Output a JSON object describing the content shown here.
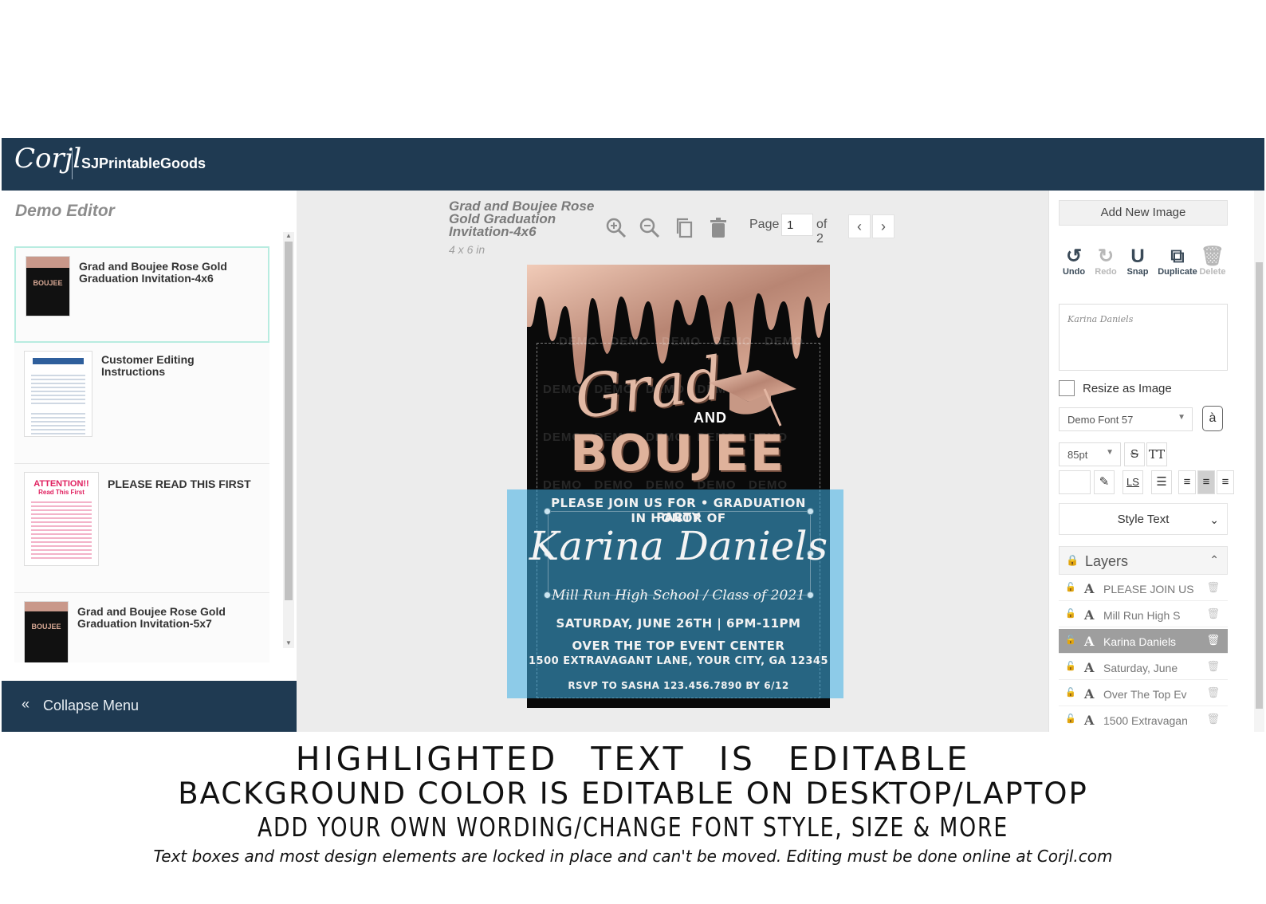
{
  "app": {
    "logo": "Corjl",
    "shop_name": "SJPrintableGoods"
  },
  "left_panel": {
    "title": "Demo Editor",
    "templates": [
      {
        "label": "Grad and Boujee Rose Gold Graduation Invitation-4x6",
        "selected": true
      },
      {
        "label": "Customer Editing Instructions",
        "selected": false
      },
      {
        "label": "PLEASE READ THIS FIRST",
        "selected": false
      },
      {
        "label": "Grad and Boujee Rose Gold Graduation Invitation-5x7",
        "selected": false
      }
    ],
    "thumb_attention": {
      "title": "ATTENTION!!",
      "subtitle": "Read This First"
    },
    "collapse_label": "Collapse Menu"
  },
  "canvas": {
    "doc_name": "Grad and Boujee Rose Gold Graduation Invitation-4x6",
    "doc_size": "4 x 6 in",
    "page_label": "Page",
    "page_value": "1",
    "of_label": "of 2",
    "icons": [
      "zoom-in-icon",
      "zoom-out-icon",
      "duplicate-page-icon",
      "delete-page-icon",
      "prev-page-icon",
      "next-page-icon"
    ]
  },
  "invitation": {
    "watermark": "DEMO",
    "grad": "Grad",
    "and": "AND",
    "boujee": "BOUJEE",
    "line1": "PLEASE JOIN US FOR • GRADUATION PARTY",
    "line2": "IN HONOR OF",
    "name": "Karina Daniels",
    "school": "Mill Run High School  /  Class of 2021",
    "date": "SATURDAY, JUNE 26TH  |  6PM-11PM",
    "venue": "OVER THE TOP EVENT CENTER",
    "address": "1500 EXTRAVAGANT LANE, YOUR CITY, GA 12345",
    "rsvp": "RSVP TO SASHA 123.456.7890 BY 6/12"
  },
  "right_panel": {
    "add_image": "Add New Image",
    "tools": [
      {
        "label": "Undo",
        "glyph": "↺",
        "enabled": true
      },
      {
        "label": "Redo",
        "glyph": "↻",
        "enabled": false
      },
      {
        "label": "Snap",
        "glyph": "U",
        "enabled": true
      },
      {
        "label": "Duplicate",
        "glyph": "⧉",
        "enabled": true
      },
      {
        "label": "Delete",
        "glyph": "🗑",
        "enabled": false
      }
    ],
    "text_preview": "Karina Daniels",
    "resize_label": "Resize as Image",
    "font": "Demo Font 57",
    "font_size": "85pt",
    "style_text": "Style Text",
    "layers_title": "Layers",
    "layers": [
      {
        "name": "PLEASE JOIN US",
        "selected": false
      },
      {
        "name": "Mill Run High S",
        "selected": false
      },
      {
        "name": "Karina Daniels",
        "selected": true
      },
      {
        "name": "Saturday, June",
        "selected": false
      },
      {
        "name": "Over The Top Ev",
        "selected": false
      },
      {
        "name": "1500 Extravagan",
        "selected": false
      }
    ]
  },
  "captions": {
    "line1": "HIGHLIGHTED TEXT IS EDITABLE",
    "line2": "BACKGROUND  COLOR IS EDITABLE ON DESKTOP/LAPTOP",
    "line3": "ADD YOUR OWN WORDING/CHANGE FONT STYLE, SIZE & MORE",
    "line4": "Text boxes and most design elements are locked in place and can't be moved. Editing must be done online at Corjl.com"
  },
  "colors": {
    "header": "#1f3a52",
    "highlight": "#3fb0e6",
    "rose_gold": "#dfb29b"
  }
}
